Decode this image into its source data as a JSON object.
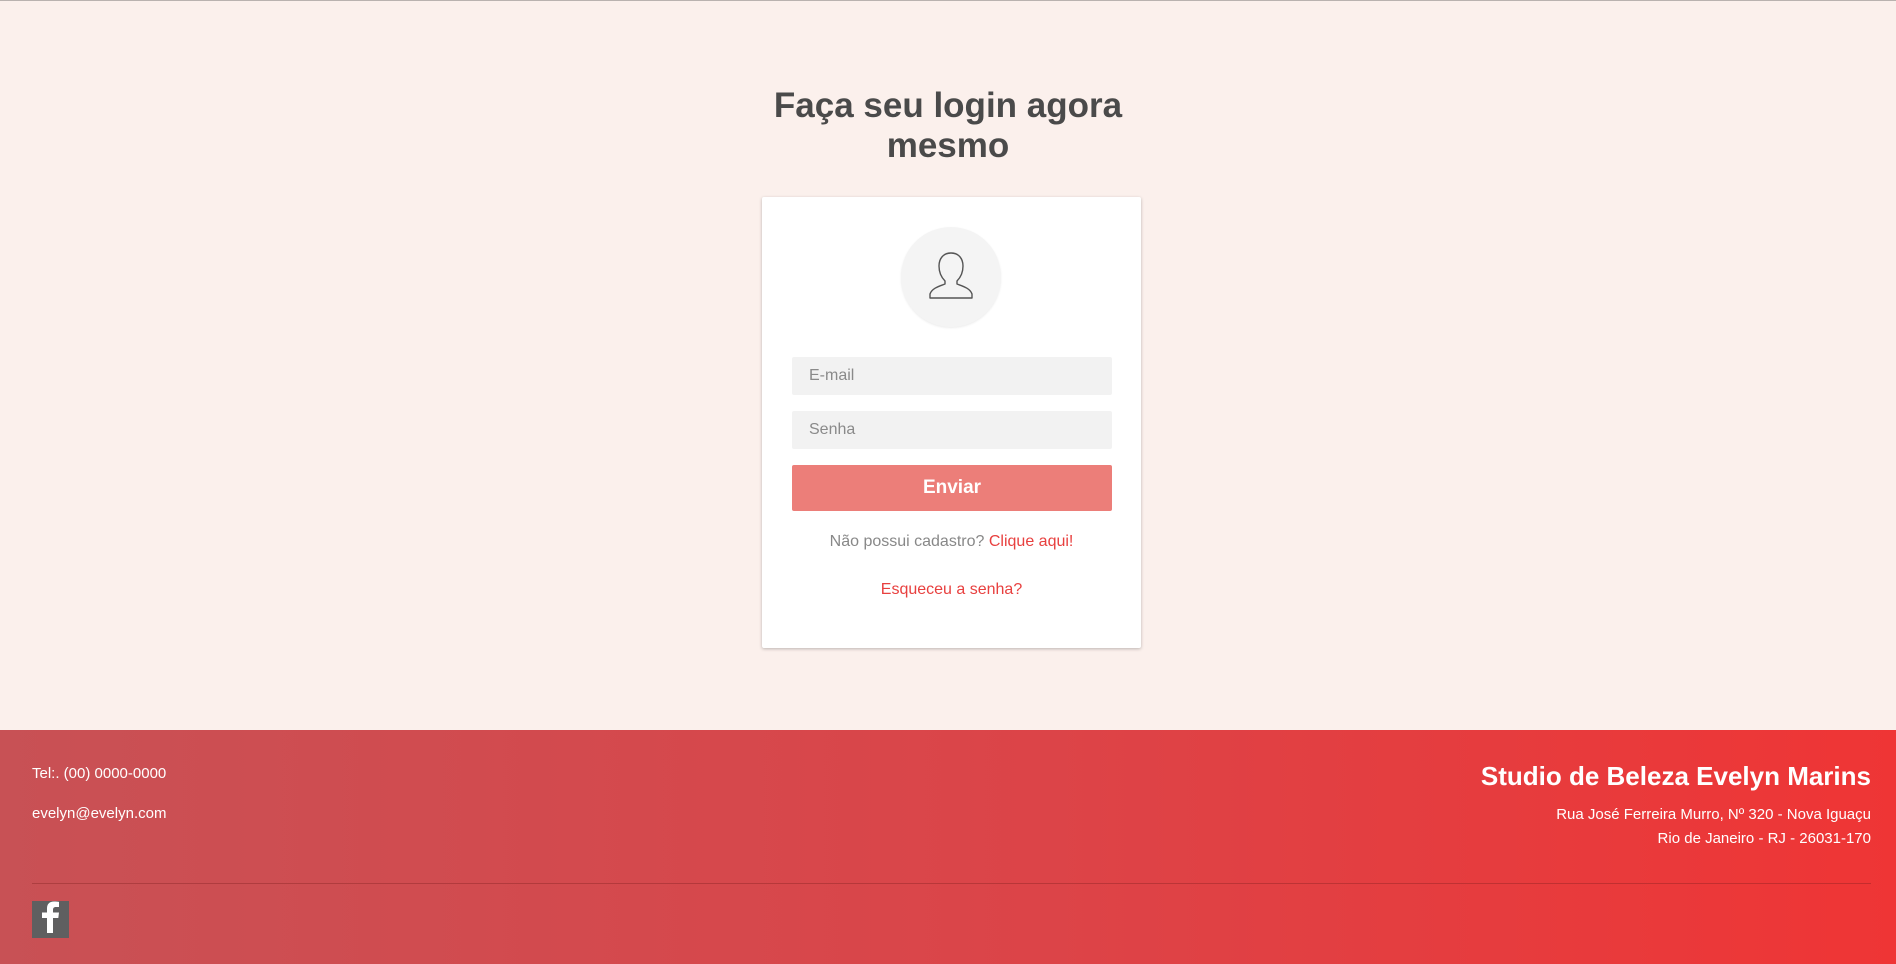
{
  "login": {
    "title": "Faça seu login agora mesmo",
    "email_placeholder": "E-mail",
    "password_placeholder": "Senha",
    "submit_label": "Enviar",
    "register_prompt": "Não possui cadastro?",
    "register_link": "Clique aqui!",
    "forgot_link": "Esqueceu a senha?",
    "avatar_icon": "user-silhouette-icon"
  },
  "footer": {
    "phone": "Tel:. (00) 0000-0000",
    "email": "evelyn@evelyn.com",
    "brand": "Studio de Beleza Evelyn Marins",
    "address_line1": "Rua José Ferreira Murro, Nº 320 - Nova Iguaçu",
    "address_line2": "Rio de Janeiro - RJ - 26031-170",
    "social_icon": "facebook-icon"
  },
  "colors": {
    "background": "#fbf0ec",
    "accent": "#ec7e79",
    "link": "#e8403f",
    "footer_start": "#c85155",
    "footer_end": "#ef3535"
  }
}
